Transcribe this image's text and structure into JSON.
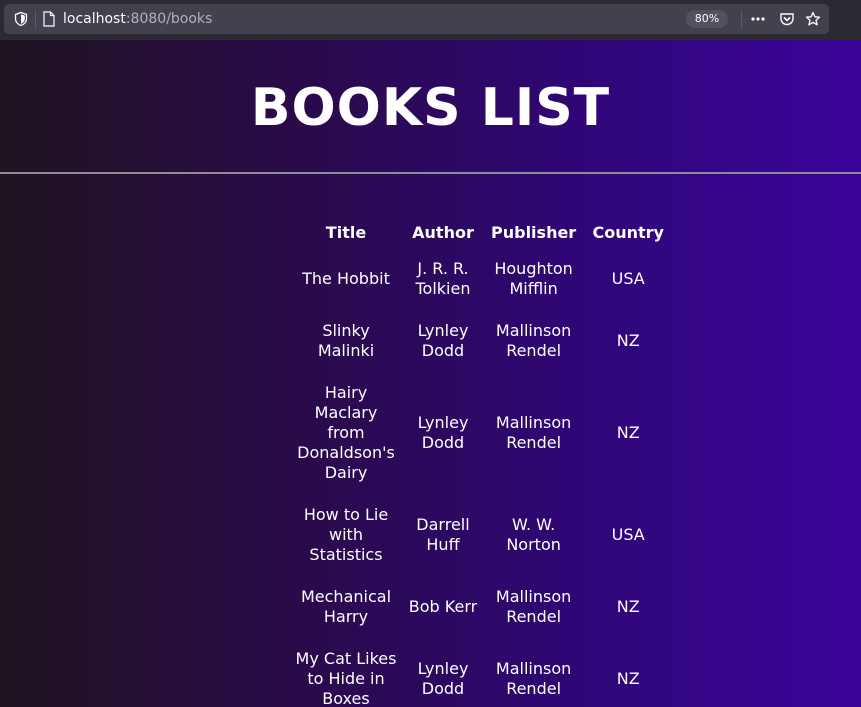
{
  "browser": {
    "url_host": "localhost",
    "url_path": ":8080/books",
    "zoom": "80%",
    "icons": [
      "shield-icon",
      "page-icon",
      "more-icon",
      "pocket-icon",
      "star-icon"
    ]
  },
  "page": {
    "heading": "BOOKS LIST",
    "columns": [
      "Title",
      "Author",
      "Publisher",
      "Country"
    ],
    "rows": [
      {
        "title": "The Hobbit",
        "author": "J. R. R. Tolkien",
        "publisher": "Houghton Mifflin",
        "country": "USA"
      },
      {
        "title": "Slinky Malinki",
        "author": "Lynley Dodd",
        "publisher": "Mallinson Rendel",
        "country": "NZ"
      },
      {
        "title": "Hairy Maclary from Donaldson's Dairy",
        "author": "Lynley Dodd",
        "publisher": "Mallinson Rendel",
        "country": "NZ"
      },
      {
        "title": "How to Lie with Statistics",
        "author": "Darrell Huff",
        "publisher": "W. W. Norton",
        "country": "USA"
      },
      {
        "title": "Mechanical Harry",
        "author": "Bob Kerr",
        "publisher": "Mallinson Rendel",
        "country": "NZ"
      },
      {
        "title": "My Cat Likes to Hide in Boxes",
        "author": "Lynley Dodd",
        "publisher": "Mallinson Rendel",
        "country": "NZ"
      }
    ]
  },
  "colors": {
    "toolbar": "#2b2a33",
    "urlbar": "#42414d",
    "gradient_start": "#1e1320",
    "gradient_end": "#3a049a",
    "text": "#ffffff"
  }
}
